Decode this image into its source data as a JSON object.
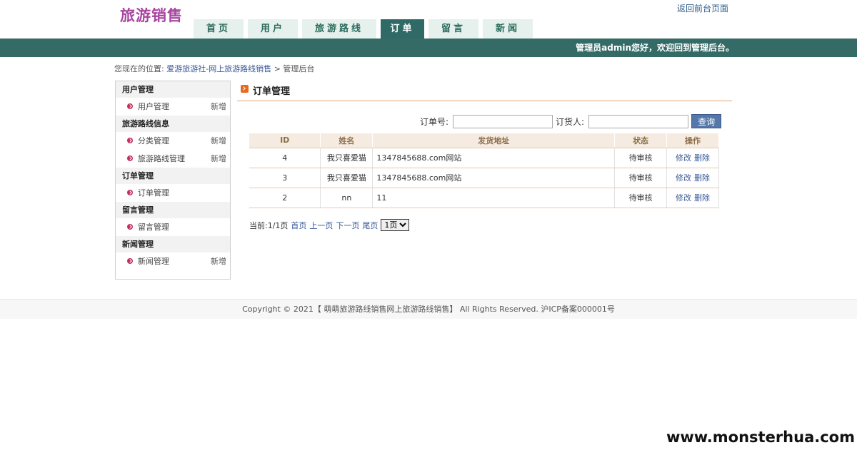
{
  "header": {
    "logo": "旅游销售",
    "back_link": "返回前台页面",
    "nav": [
      {
        "label": "首页",
        "active": false
      },
      {
        "label": "用户",
        "active": false
      },
      {
        "label": "旅游路线",
        "active": false
      },
      {
        "label": "订单",
        "active": true
      },
      {
        "label": "留言",
        "active": false
      },
      {
        "label": "新闻",
        "active": false
      }
    ],
    "welcome": "管理员admin您好，欢迎回到管理后台。"
  },
  "breadcrumb": {
    "prefix": "您现在的位置:",
    "site": "爱游旅游社-网上旅游路线销售",
    "sep": ">",
    "current": "管理后台"
  },
  "sidebar": {
    "groups": [
      {
        "title": "用户管理",
        "items": [
          {
            "label": "用户管理",
            "add": "新增"
          }
        ]
      },
      {
        "title": "旅游路线信息",
        "items": [
          {
            "label": "分类管理",
            "add": "新增"
          },
          {
            "label": "旅游路线管理",
            "add": "新增"
          }
        ]
      },
      {
        "title": "订单管理",
        "items": [
          {
            "label": "订单管理",
            "add": ""
          }
        ]
      },
      {
        "title": "留言管理",
        "items": [
          {
            "label": "留言管理",
            "add": ""
          }
        ]
      },
      {
        "title": "新闻管理",
        "items": [
          {
            "label": "新闻管理",
            "add": "新增"
          }
        ]
      }
    ]
  },
  "main": {
    "title": "订单管理",
    "search": {
      "order_no_label": "订单号:",
      "order_no_value": "",
      "buyer_label": "订货人:",
      "buyer_value": "",
      "button": "查询"
    },
    "table": {
      "headers": [
        "ID",
        "姓名",
        "发货地址",
        "状态",
        "操作"
      ],
      "rows": [
        {
          "id": "4",
          "name": "我只喜爱猫",
          "address": "1347845688.com网站",
          "status": "待审核",
          "edit": "修改",
          "delete": "删除"
        },
        {
          "id": "3",
          "name": "我只喜爱猫",
          "address": "1347845688.com网站",
          "status": "待审核",
          "edit": "修改",
          "delete": "删除"
        },
        {
          "id": "2",
          "name": "nn",
          "address": "11",
          "status": "待审核",
          "edit": "修改",
          "delete": "删除"
        }
      ]
    },
    "pager": {
      "current": "当前:1/1页",
      "first": "首页",
      "prev": "上一页",
      "next": "下一页",
      "last": "尾页",
      "select_value": "1页"
    }
  },
  "footer": {
    "text": "Copyright © 2021【 萌萌旅游路线销售网上旅游路线销售】 All Rights Reserved. 沪ICP备案000001号"
  },
  "watermark": "www.monsterhua.com"
}
